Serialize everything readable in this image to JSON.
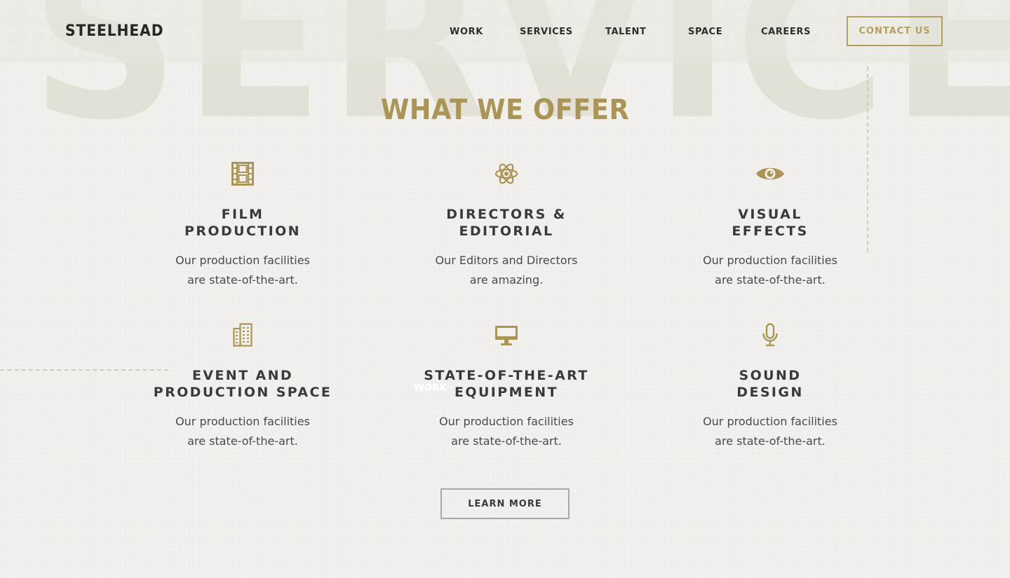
{
  "brand": {
    "logo_text": "STEELHEAD",
    "accent_color": "#ab9556",
    "text_color": "#3a3a3a"
  },
  "background": {
    "big_word": "SERVICES",
    "overlay_label": "WORK"
  },
  "nav": {
    "items": [
      {
        "label": "WORK"
      },
      {
        "label": "SERVICES"
      },
      {
        "label": "TALENT"
      },
      {
        "label": "SPACE"
      },
      {
        "label": "CAREERS"
      }
    ],
    "contact_label": "CONTACT US"
  },
  "section": {
    "heading": "WHAT WE OFFER",
    "services": [
      {
        "icon": "film-icon",
        "title_line1": "FILM",
        "title_line2": "PRODUCTION",
        "desc_line1": "Our production facilities",
        "desc_line2": "are state-of-the-art."
      },
      {
        "icon": "atom-icon",
        "title_line1": "DIRECTORS &",
        "title_line2": "EDITORIAL",
        "desc_line1": "Our Editors and Directors",
        "desc_line2": "are amazing."
      },
      {
        "icon": "eye-icon",
        "title_line1": "VISUAL",
        "title_line2": "EFFECTS",
        "desc_line1": "Our production facilities",
        "desc_line2": "are state-of-the-art."
      },
      {
        "icon": "building-icon",
        "title_line1": "EVENT AND",
        "title_line2": "PRODUCTION SPACE",
        "desc_line1": "Our production facilities",
        "desc_line2": "are state-of-the-art."
      },
      {
        "icon": "desktop-icon",
        "title_line1": "STATE-OF-THE-ART",
        "title_line2": "EQUIPMENT",
        "desc_line1": "Our production facilities",
        "desc_line2": "are state-of-the-art."
      },
      {
        "icon": "microphone-icon",
        "title_line1": "SOUND",
        "title_line2": "DESIGN",
        "desc_line1": "Our production facilities",
        "desc_line2": "are state-of-the-art."
      }
    ],
    "learn_more_label": "LEARN MORE"
  }
}
